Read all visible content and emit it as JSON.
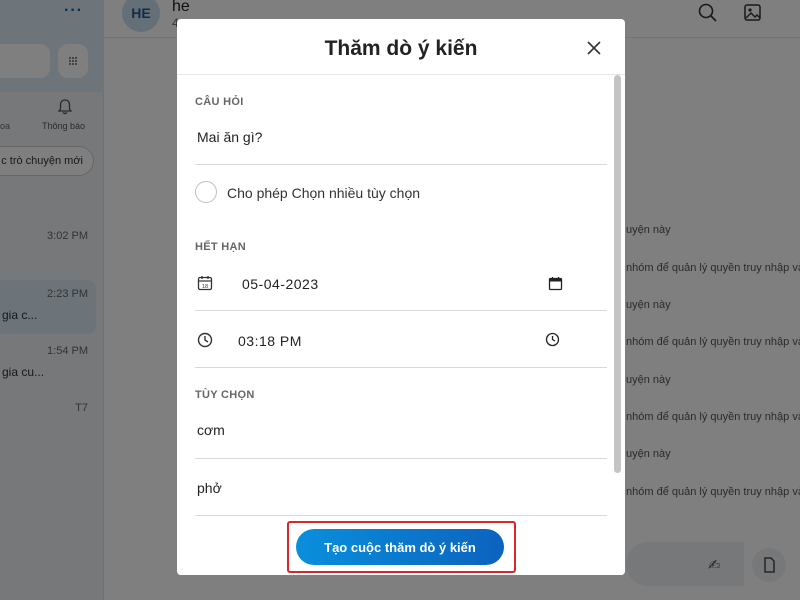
{
  "background": {
    "sidebar": {
      "notifications_label": "Thông báo",
      "side_fragment": "oa",
      "new_chat_label": "c trò chuyện mới",
      "chats": [
        {
          "time": "3:02 PM",
          "preview": ""
        },
        {
          "time": "2:23 PM",
          "preview": "gia c..."
        },
        {
          "time": "1:54 PM",
          "preview": "gia cu..."
        },
        {
          "time": "T7",
          "preview": ""
        }
      ]
    },
    "header": {
      "avatar_initials": "HE",
      "contact_name": "he",
      "contact_sub": "4"
    },
    "messages": [
      "uyện này",
      "nhóm để quản lý quyền truy nhập và",
      "uyện này",
      "nhóm để quản lý quyền truy nhập và",
      "uyện này",
      "nhóm để quản lý quyền truy nhập và",
      "uyện này",
      "nhóm để quản lý quyền truy nhập và"
    ]
  },
  "dialog": {
    "title": "Thăm dò ý kiến",
    "question_label": "CÂU HỎI",
    "question_value": "Mai ăn gì?",
    "multi_choice_label": "Cho phép Chọn nhiều tùy chọn",
    "expiry_label": "HẾT HẠN",
    "date_value": "05-04-2023",
    "time_value": "03:18  PM",
    "options_label": "TÙY CHỌN",
    "options": [
      "cơm",
      "phở"
    ],
    "submit_label": "Tạo cuộc thăm dò ý kiến"
  },
  "colors": {
    "accent_start": "#0a8fdd",
    "accent_end": "#0b63be",
    "highlight": "#d8262c"
  }
}
